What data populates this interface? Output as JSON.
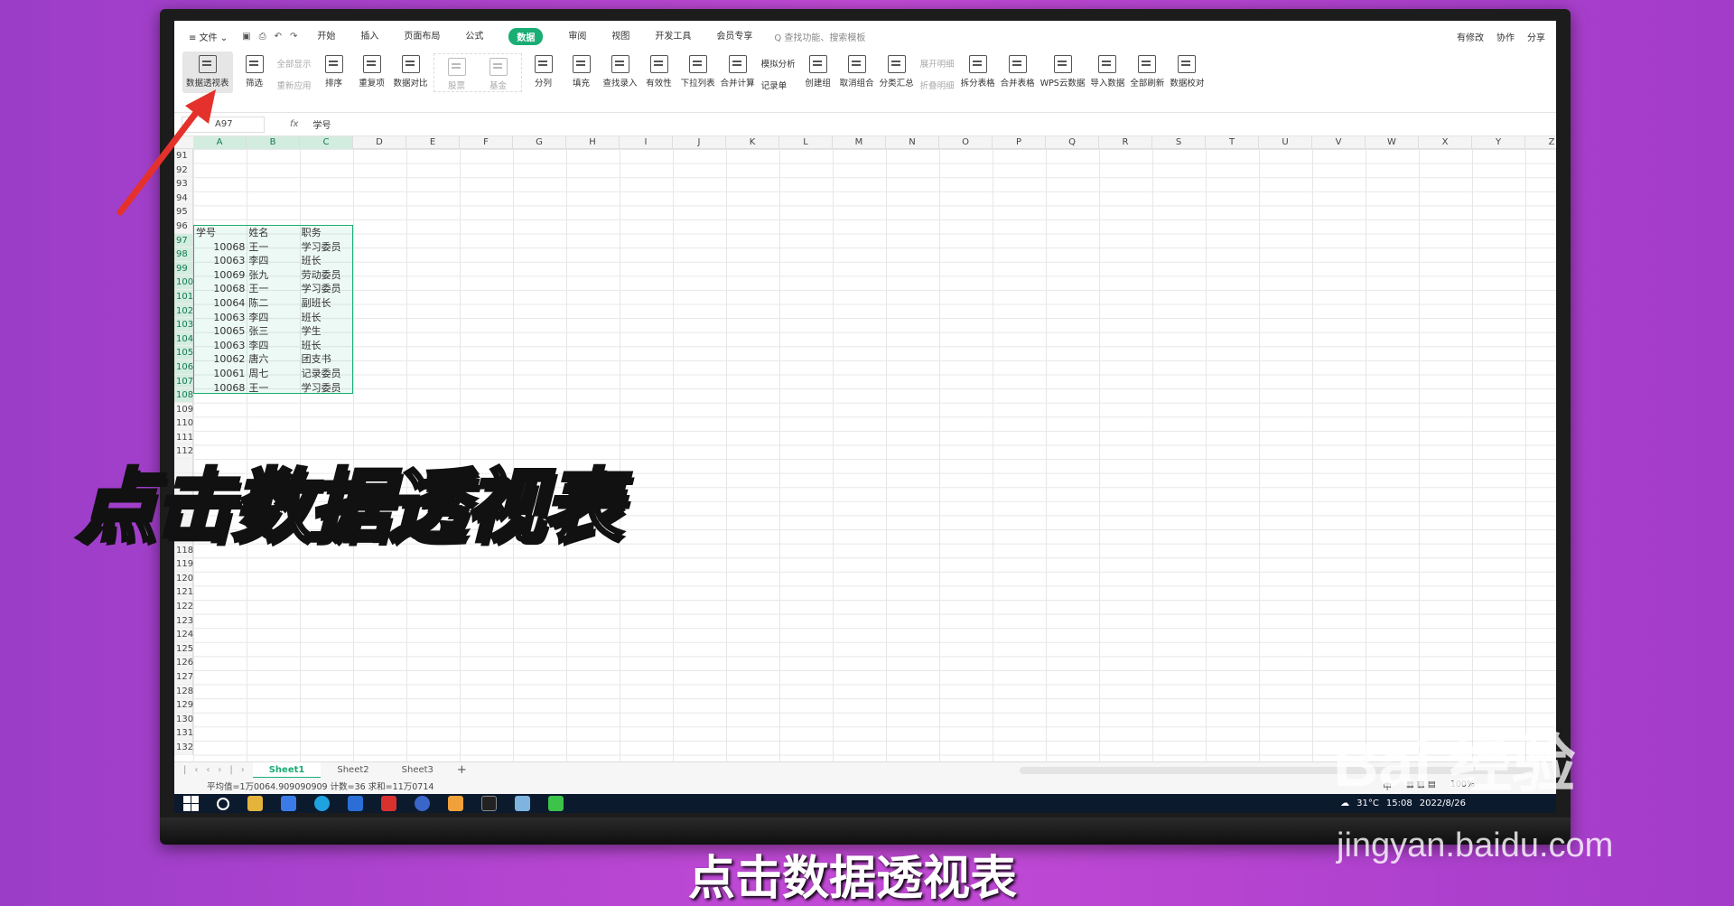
{
  "menubar": {
    "file": "≡ 文件 ⌄",
    "tabs": [
      "开始",
      "插入",
      "页面布局",
      "公式",
      "数据",
      "审阅",
      "视图",
      "开发工具",
      "会员专享"
    ],
    "active_tab": "数据",
    "search": "Q 查找功能、搜索模板",
    "right": [
      "有修改",
      "协作",
      "分享"
    ]
  },
  "ribbon": {
    "pivot": "数据透视表",
    "filter": "筛选",
    "show_all": "全部显示",
    "reapply": "重新应用",
    "sort": "排序",
    "duplicates": "重复项",
    "compare": "数据对比",
    "stock": "股票",
    "fund": "基金",
    "split": "分列",
    "fill": "填充",
    "lookup": "查找录入",
    "validity": "有效性",
    "dropdown": "下拉列表",
    "consolidate": "合并计算",
    "simulate": "模拟分析",
    "record": "记录单",
    "group": "创建组",
    "ungroup": "取消组合",
    "subtotal": "分类汇总",
    "expand": "展开明细",
    "collapse": "折叠明细",
    "split_table": "拆分表格",
    "merge_table": "合并表格",
    "cloud": "WPS云数据",
    "import": "导入数据",
    "refresh": "全部刷新",
    "verify": "数据校对"
  },
  "formula": {
    "cell_ref": "A97",
    "fx": "fx",
    "value": "学号"
  },
  "columns": [
    "A",
    "B",
    "C",
    "D",
    "E",
    "F",
    "G",
    "H",
    "I",
    "J",
    "K",
    "L",
    "M",
    "N",
    "O",
    "P",
    "Q",
    "R",
    "S",
    "T",
    "U",
    "V",
    "W",
    "X",
    "Y",
    "Z"
  ],
  "rows": [
    "91",
    "92",
    "93",
    "94",
    "95",
    "96",
    "97",
    "98",
    "99",
    "100",
    "101",
    "102",
    "103",
    "104",
    "105",
    "106",
    "107",
    "108",
    "109",
    "110",
    "111",
    "112",
    "",
    "",
    "",
    "",
    "",
    "",
    "118",
    "119",
    "120",
    "121",
    "122",
    "123",
    "124",
    "125",
    "126",
    "127",
    "128",
    "129",
    "130",
    "131",
    "132"
  ],
  "table": {
    "headers": [
      "学号",
      "姓名",
      "职务"
    ],
    "rows": [
      [
        "10068",
        "王一",
        "学习委员"
      ],
      [
        "10063",
        "李四",
        "班长"
      ],
      [
        "10069",
        "张九",
        "劳动委员"
      ],
      [
        "10068",
        "王一",
        "学习委员"
      ],
      [
        "10064",
        "陈二",
        "副班长"
      ],
      [
        "10063",
        "李四",
        "班长"
      ],
      [
        "10065",
        "张三",
        "学生"
      ],
      [
        "10063",
        "李四",
        "班长"
      ],
      [
        "10062",
        "唐六",
        "团支书"
      ],
      [
        "10061",
        "周七",
        "记录委员"
      ],
      [
        "10068",
        "王一",
        "学习委员"
      ]
    ]
  },
  "sheets": [
    "Sheet1",
    "Sheet2",
    "Sheet3"
  ],
  "status": {
    "stats": "平均值=1万0064.909090909  计数=36  求和=11万0714",
    "input": "中",
    "zoom": "100%"
  },
  "tray": {
    "weather": "31°C",
    "time": "15:08",
    "date": "2022/8/26"
  },
  "overlay": {
    "big_caption": "点击数据透视表",
    "bottom_caption": "点击数据透视表",
    "watermark": "Bai  经验",
    "watermark_url": "jingyan.baidu.com"
  },
  "colors": {
    "accent": "#1aad74",
    "arrow": "#e5312b"
  }
}
